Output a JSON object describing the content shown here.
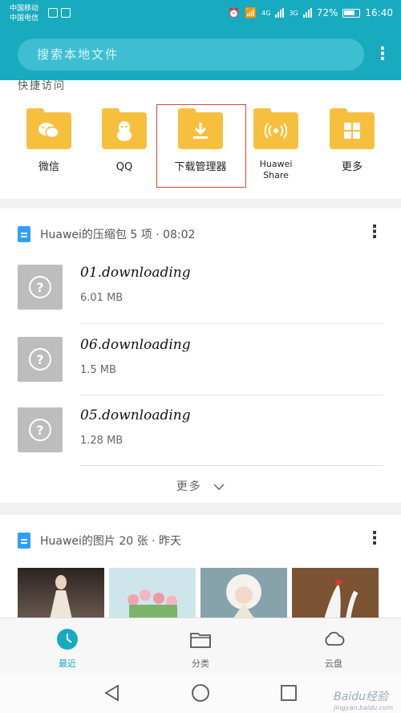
{
  "status": {
    "carrier1": "中国移动",
    "carrier2": "中国电信",
    "net_4g": "4G",
    "net_3g": "3G",
    "battery": "72%",
    "time": "16:40"
  },
  "search": {
    "placeholder": "搜索本地文件"
  },
  "quick_access": {
    "title": "快捷访问",
    "items": [
      {
        "label": "微信",
        "icon": "wechat-icon"
      },
      {
        "label": "QQ",
        "icon": "qq-penguin-icon"
      },
      {
        "label": "下载管理器",
        "icon": "download-icon"
      },
      {
        "label": "Huawei Share",
        "icon": "share-wireless-icon"
      },
      {
        "label": "更多",
        "icon": "grid-icon"
      }
    ]
  },
  "recent_archive": {
    "header": "Huawei的压缩包 5 项 · 08:02",
    "files": [
      {
        "name": "01.downloading",
        "size": "6.01 MB"
      },
      {
        "name": "06.downloading",
        "size": "1.5 MB"
      },
      {
        "name": "05.downloading",
        "size": "1.28 MB"
      }
    ],
    "more_label": "更多"
  },
  "recent_photos": {
    "header": "Huawei的图片 20 张 · 昨天"
  },
  "nav": {
    "tabs": [
      {
        "label": "最近",
        "icon": "clock-icon",
        "active": true
      },
      {
        "label": "分类",
        "icon": "folder-icon",
        "active": false
      },
      {
        "label": "云盘",
        "icon": "cloud-icon",
        "active": false
      }
    ]
  },
  "watermark": {
    "text": "Baidu经验",
    "sub": "jingyan.baidu.com"
  },
  "colors": {
    "accent": "#18aabf",
    "folder": "#f6c03e",
    "highlight": "#d9433a"
  }
}
